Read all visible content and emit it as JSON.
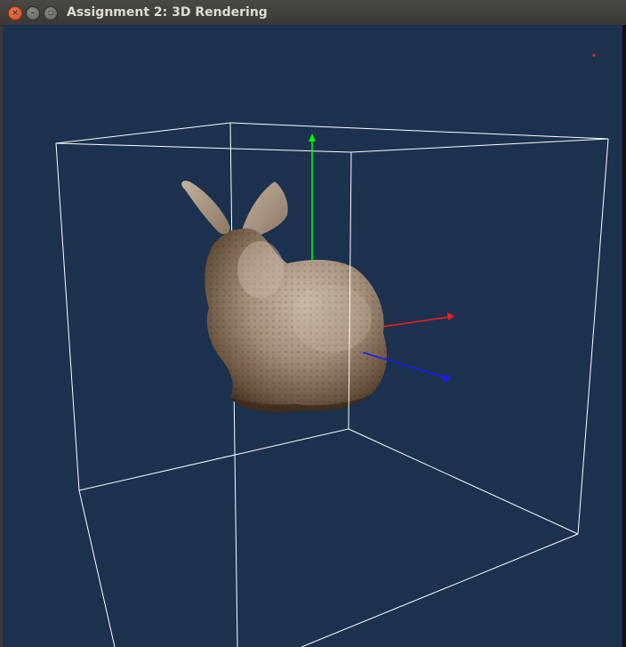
{
  "window": {
    "title": "Assignment 2: 3D Rendering",
    "controls": {
      "close_icon": "close-icon",
      "minimize_icon": "minimize-icon",
      "maximize_icon": "maximize-icon"
    }
  },
  "scene": {
    "background_color": "#1c324e",
    "bounding_box_color": "#ffffff",
    "model": "bunny",
    "model_color": "#a89886",
    "axes": {
      "y_color": "#00ff00",
      "x_color": "#ff1a1a",
      "z_color": "#1a1aff"
    }
  }
}
